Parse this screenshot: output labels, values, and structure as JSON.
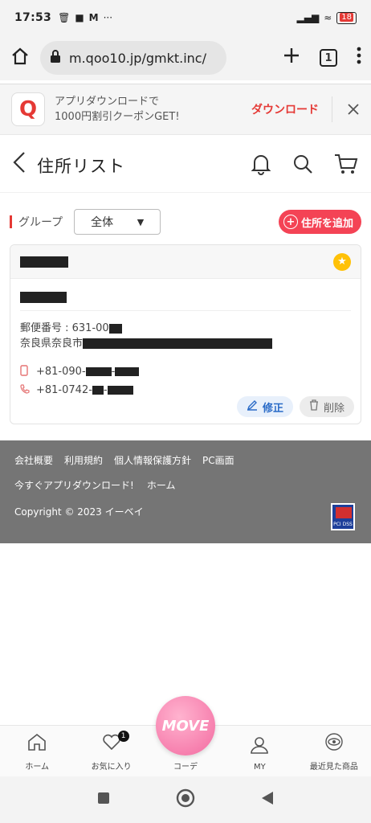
{
  "status_bar": {
    "time": "17:53",
    "battery": "18"
  },
  "browser": {
    "url": "m.qoo10.jp/gmkt.inc/",
    "tab_count": "1"
  },
  "app_banner": {
    "logo_letter": "Q",
    "line1": "アプリダウンロードで",
    "line2": "1000円割引クーポンGET!",
    "download_label": "ダウンロード"
  },
  "header": {
    "title": "住所リスト"
  },
  "group": {
    "label": "グループ",
    "selected": "全体",
    "add_label": "住所を追加"
  },
  "address_card": {
    "postal_label": "郵便番号 : 631-00",
    "address_prefix": "奈良県奈良市",
    "phone1_prefix": "+81-090-",
    "phone2_prefix": "+81-0742-",
    "edit_label": "修正",
    "delete_label": "削除"
  },
  "footer": {
    "links": [
      "会社概要",
      "利用規約",
      "個人情報保護方針",
      "PC画面"
    ],
    "links2": [
      "今すぐアプリダウンロード!",
      "ホーム"
    ],
    "copyright": "Copyright © 2023 イーベイ",
    "seal_text": "PCI DSS"
  },
  "bottom_nav": {
    "items": [
      {
        "label": "ホーム",
        "icon": "home-icon"
      },
      {
        "label": "お気に入り",
        "icon": "heart-icon",
        "badge": "1"
      },
      {
        "label": "コーデ",
        "icon": "move-icon"
      },
      {
        "label": "MY",
        "icon": "user-icon"
      },
      {
        "label": "最近見た商品",
        "icon": "eye-icon"
      }
    ],
    "move_label": "MOVE"
  },
  "colors": {
    "accent": "#e53935",
    "add_button": "#f44355",
    "footer_bg": "#757575",
    "edit_blue": "#2a6bc7",
    "star": "#ffc107"
  }
}
